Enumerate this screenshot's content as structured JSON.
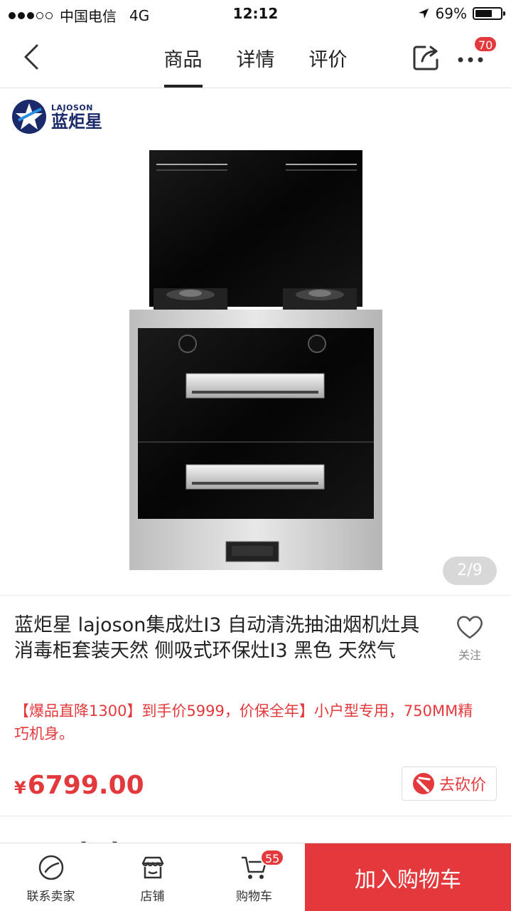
{
  "status_bar": {
    "carrier": "中国电信",
    "network": "4G",
    "time": "12:12",
    "battery": "69%",
    "battery_level": 0.69
  },
  "nav": {
    "tabs": [
      {
        "label": "商品",
        "active": true
      },
      {
        "label": "详情",
        "active": false
      },
      {
        "label": "评价",
        "active": false
      }
    ],
    "more_badge": "70"
  },
  "gallery": {
    "brand_en": "LAJOSON",
    "brand_cn": "蓝炬星",
    "page_indicator": "2/9"
  },
  "product": {
    "title": "蓝炬星 lajoson集成灶I3 自动清洗抽油烟机灶具消毒柜套装天然 侧吸式环保灶I3 黑色 天然气",
    "follow_label": "关注",
    "promo": "【爆品直降1300】到手价5999，价保全年】小户型专用，750MM精巧机身。",
    "price_currency": "¥",
    "price_value": "6799.00",
    "bargain_label": "去砍价"
  },
  "peek_text": "【 ... 】 ...",
  "bottom_bar": {
    "contact_label": "联系卖家",
    "shop_label": "店铺",
    "cart_label": "购物车",
    "cart_badge": "55",
    "add_to_cart_label": "加入购物车"
  },
  "colors": {
    "accent": "#e4393c",
    "brand": "#1b2a6b"
  }
}
